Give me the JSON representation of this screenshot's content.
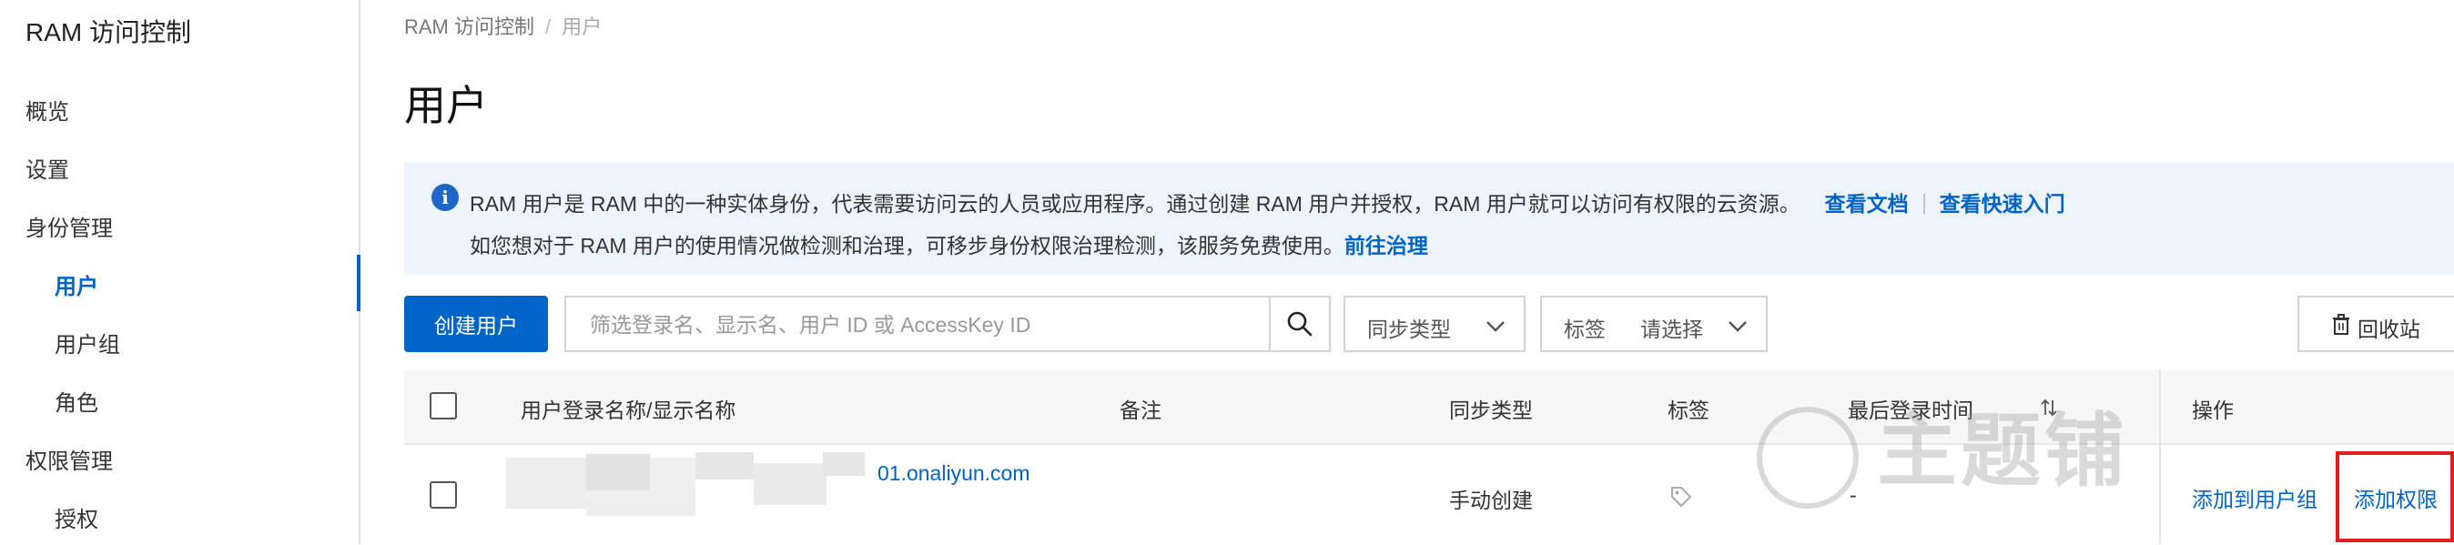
{
  "sidebar": {
    "title": "RAM 访问控制",
    "items": [
      {
        "label": "概览"
      },
      {
        "label": "设置"
      },
      {
        "label": "身份管理"
      },
      {
        "label": "用户"
      },
      {
        "label": "用户组"
      },
      {
        "label": "角色"
      },
      {
        "label": "权限管理"
      },
      {
        "label": "授权"
      }
    ],
    "active_item": "用户"
  },
  "breadcrumb": {
    "root": "RAM 访问控制",
    "separator": "/",
    "current": "用户"
  },
  "page": {
    "title": "用户"
  },
  "notice": {
    "line1": "RAM 用户是 RAM 中的一种实体身份，代表需要访问云的人员或应用程序。通过创建 RAM 用户并授权，RAM 用户就可以访问有权限的云资源。",
    "link_docs": "查看文档",
    "link_quickstart": "查看快速入门",
    "line2": "如您想对于 RAM 用户的使用情况做检测和治理，可移步身份权限治理检测，该服务免费使用。",
    "link_governance": "前往治理"
  },
  "toolbar": {
    "create_label": "创建用户",
    "search_placeholder": "筛选登录名、显示名、用户 ID 或 AccessKey ID",
    "sync_type_label": "同步类型",
    "tag_label": "标签",
    "tag_value": "请选择",
    "recycle_label": "回收站"
  },
  "table": {
    "columns": [
      "用户登录名称/显示名称",
      "备注",
      "同步类型",
      "标签",
      "最后登录时间",
      "操作"
    ],
    "rows": [
      {
        "login_name_suffix": "01.onaliyun.com",
        "remark": "",
        "sync_type": "手动创建",
        "last_login": "-",
        "actions": [
          "添加到用户组",
          "添加权限"
        ]
      }
    ]
  },
  "watermark": "主题铺",
  "colors": {
    "accent": "#0064c8",
    "notice_bg": "#eef4fb",
    "highlight": "#e01e1e"
  }
}
